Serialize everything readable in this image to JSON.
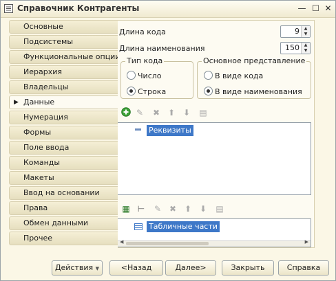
{
  "window": {
    "title": "Справочник Контрагенты"
  },
  "nav": {
    "items": [
      {
        "label": "Основные"
      },
      {
        "label": "Подсистемы"
      },
      {
        "label": "Функциональные опции"
      },
      {
        "label": "Иерархия"
      },
      {
        "label": "Владельцы"
      },
      {
        "label": "Данные"
      },
      {
        "label": "Нумерация"
      },
      {
        "label": "Формы"
      },
      {
        "label": "Поле ввода"
      },
      {
        "label": "Команды"
      },
      {
        "label": "Макеты"
      },
      {
        "label": "Ввод на основании"
      },
      {
        "label": "Права"
      },
      {
        "label": "Обмен данными"
      },
      {
        "label": "Прочее"
      }
    ],
    "active": "Данные"
  },
  "fields": {
    "code_length_label": "Длина кода",
    "code_length_value": "9",
    "name_length_label": "Длина наименования",
    "name_length_value": "150"
  },
  "code_type": {
    "title": "Тип кода",
    "options": [
      "Число",
      "Строка"
    ],
    "selected": "Строка"
  },
  "main_presentation": {
    "title": "Основное представление",
    "options": [
      "В виде кода",
      "В виде наименования"
    ],
    "selected": "В виде наименования"
  },
  "attributes_tree": {
    "item": "Реквизиты"
  },
  "tabular_tree": {
    "item": "Табличные части"
  },
  "buttons": {
    "actions": "Действия",
    "back": "<Назад",
    "next": "Далее>",
    "close": "Закрыть",
    "help": "Справка"
  }
}
